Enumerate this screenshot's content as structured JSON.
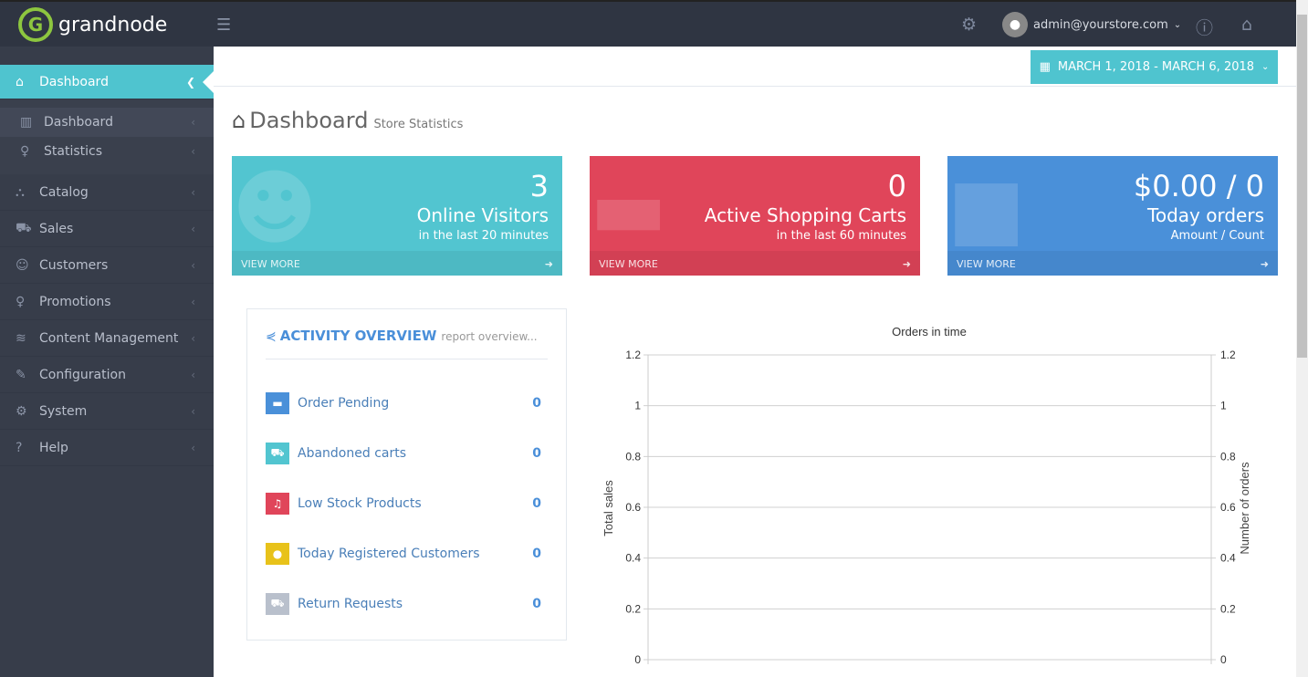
{
  "header": {
    "brand": "grandnode",
    "user": "admin@yourstore.com"
  },
  "sidebar": {
    "items": [
      {
        "label": "Dashboard",
        "icon": "home-icon"
      },
      {
        "label": "Catalog",
        "icon": "sitemap-icon"
      },
      {
        "label": "Sales",
        "icon": "cart-icon"
      },
      {
        "label": "Customers",
        "icon": "users-icon"
      },
      {
        "label": "Promotions",
        "icon": "bulb-icon"
      },
      {
        "label": "Content Management",
        "icon": "layers-icon"
      },
      {
        "label": "Configuration",
        "icon": "wrench-icon"
      },
      {
        "label": "System",
        "icon": "gear-icon"
      },
      {
        "label": "Help",
        "icon": "question-icon"
      }
    ],
    "sub": [
      {
        "label": "Dashboard"
      },
      {
        "label": "Statistics"
      }
    ]
  },
  "date_range": "MARCH 1, 2018 - MARCH 6, 2018",
  "page": {
    "title": "Dashboard",
    "subtitle": "Store Statistics"
  },
  "cards": [
    {
      "value": "3",
      "label": "Online Visitors",
      "sub": "in the last 20 minutes",
      "more": "VIEW MORE",
      "color": "#52c5d0"
    },
    {
      "value": "0",
      "label": "Active Shopping Carts",
      "sub": "in the last 60 minutes",
      "more": "VIEW MORE",
      "color": "#e0455a"
    },
    {
      "value": "$0.00 / 0",
      "label": "Today orders",
      "sub": "Amount / Count",
      "more": "VIEW MORE",
      "color": "#4a90d9"
    }
  ],
  "activity": {
    "title": "ACTIVITY OVERVIEW",
    "subtitle": "report overview...",
    "rows": [
      {
        "label": "Order Pending",
        "value": "0",
        "color": "#4a90d9"
      },
      {
        "label": "Abandoned carts",
        "value": "0",
        "color": "#52c5d0"
      },
      {
        "label": "Low Stock Products",
        "value": "0",
        "color": "#e0455a"
      },
      {
        "label": "Today Registered Customers",
        "value": "0",
        "color": "#e8c21a"
      },
      {
        "label": "Return Requests",
        "value": "0",
        "color": "#b9c0cc"
      }
    ]
  },
  "chart_data": {
    "type": "line",
    "title": "Orders in time",
    "ylabel": "Total sales",
    "y2label": "Number of orders",
    "ylim": [
      0,
      1.2
    ],
    "y2lim": [
      0,
      1.2
    ],
    "yticks": [
      "0",
      "0.2",
      "0.4",
      "0.6",
      "0.8",
      "1",
      "1.2"
    ],
    "series": [],
    "grid": true
  }
}
